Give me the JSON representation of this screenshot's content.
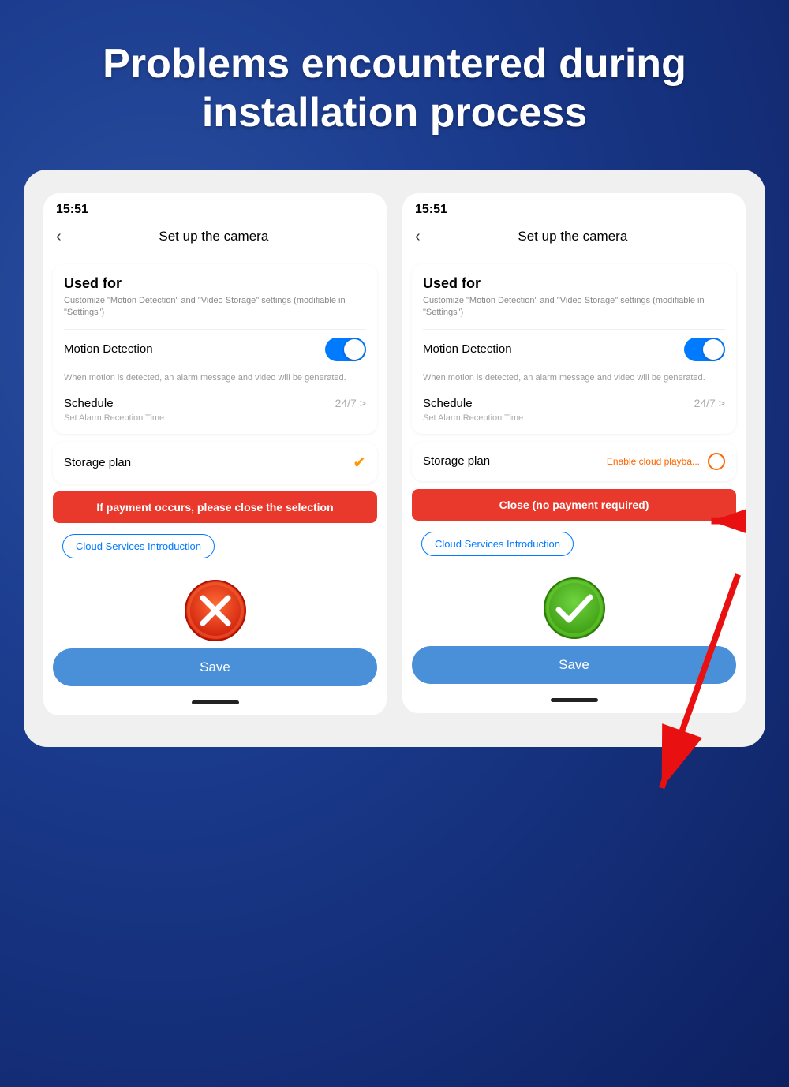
{
  "header": {
    "title": "Problems encountered during installation process"
  },
  "left_panel": {
    "time": "15:51",
    "screen_title": "Set up  the camera",
    "used_for_title": "Used for",
    "used_for_subtitle": "Customize \"Motion Detection\" and \"Video Storage\" settings (modifiable in \"Settings\")",
    "motion_detection_label": "Motion Detection",
    "motion_detection_desc": "When motion is detected, an alarm message and video will be generated.",
    "schedule_label": "Schedule",
    "schedule_value": "24/7",
    "schedule_desc": "Set Alarm Reception Time",
    "storage_label": "Storage plan",
    "warning_text": "If payment occurs, please close the selection",
    "cloud_intro": "Cloud Services Introduction",
    "save_label": "Save"
  },
  "right_panel": {
    "time": "15:51",
    "screen_title": "Set up  the camera",
    "used_for_title": "Used for",
    "used_for_subtitle": "Customize \"Motion Detection\" and \"Video Storage\" settings (modifiable in \"Settings\")",
    "motion_detection_label": "Motion Detection",
    "motion_detection_desc": "When motion is detected, an alarm message and video will be generated.",
    "schedule_label": "Schedule",
    "schedule_value": "24/7",
    "schedule_desc": "Set Alarm Reception Time",
    "storage_label": "Storage plan",
    "enable_cloud_text": "Enable cloud playba...",
    "close_btn_text": "Close (no payment required)",
    "cloud_intro": "Cloud Services Introduction",
    "save_label": "Save"
  },
  "bottom_nav": {
    "dots": [
      "active",
      "inactive"
    ]
  }
}
